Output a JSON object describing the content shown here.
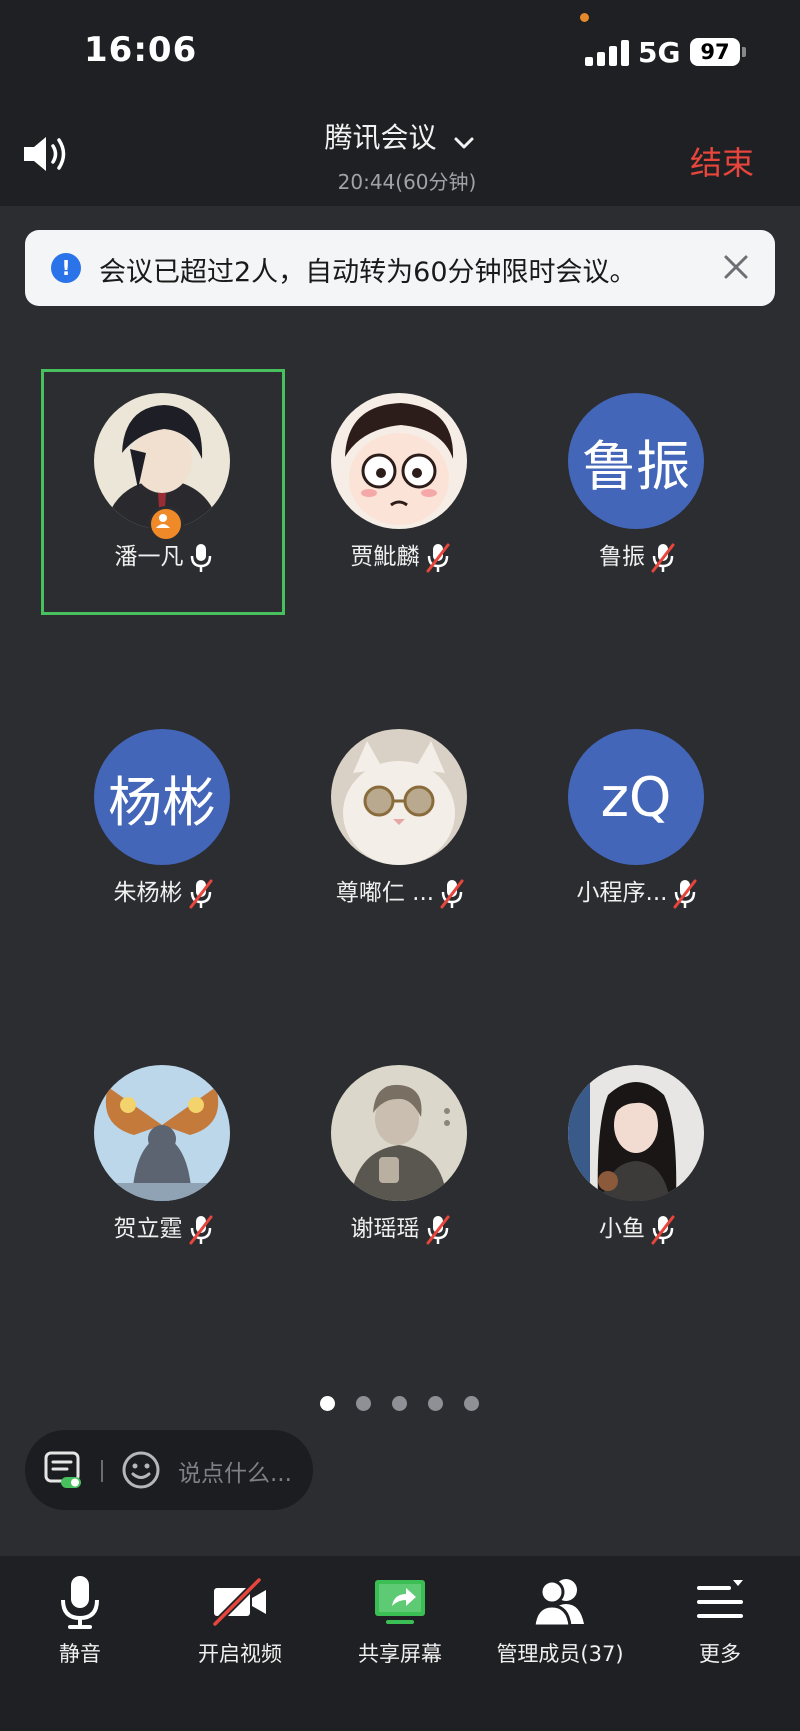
{
  "status_bar": {
    "time": "16:06",
    "network": "5G",
    "battery": "97"
  },
  "header": {
    "title": "腾讯会议",
    "subtitle": "20:44(60分钟)",
    "end_label": "结束"
  },
  "notice": {
    "text": "会议已超过2人，自动转为60分钟限时会议。"
  },
  "participants": [
    {
      "name": "潘一凡",
      "mic": "on"
    },
    {
      "name": "贾魮麟",
      "mic": "muted"
    },
    {
      "name": "鲁振",
      "avatar_text": "鲁振",
      "mic": "muted"
    },
    {
      "name": "朱杨彬",
      "avatar_text": "杨彬",
      "mic": "muted"
    },
    {
      "name": "尊嘟仁 ...",
      "mic": "muted"
    },
    {
      "name": "小程序...",
      "avatar_text": "zQ",
      "mic": "muted"
    },
    {
      "name": "贺立霆",
      "mic": "muted"
    },
    {
      "name": "谢瑶瑶",
      "mic": "muted"
    },
    {
      "name": "小鱼",
      "mic": "muted"
    }
  ],
  "pager": {
    "pages": 5,
    "current": 1
  },
  "chat": {
    "placeholder": "说点什么..."
  },
  "toolbar": {
    "mute": "静音",
    "video": "开启视频",
    "share": "共享屏幕",
    "members": "管理成员(37)",
    "more": "更多"
  },
  "colors": {
    "active_border": "#47c05d",
    "end": "#e8453c",
    "text_avatar": "#4466b8",
    "info": "#2a73e8"
  }
}
